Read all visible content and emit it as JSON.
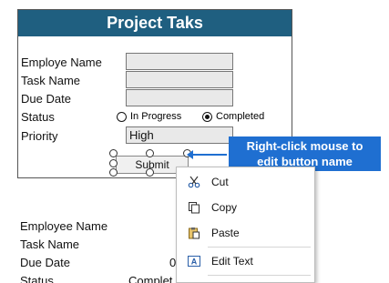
{
  "form": {
    "title": "Project Taks",
    "labels": {
      "employee_name": "Employe  Name",
      "task_name": "Task Name",
      "due_date": "Due Date",
      "status": "Status",
      "priority": "Priority"
    },
    "fields": {
      "employee_name": "",
      "task_name": "",
      "due_date": "",
      "priority": "High"
    },
    "status_options": [
      {
        "label": "In Progress",
        "selected": false
      },
      {
        "label": "Completed",
        "selected": true
      }
    ],
    "submit_label": "Submit"
  },
  "callout": {
    "line1": "Right-click mouse to",
    "line2": "edit button name",
    "color": "#1f6fd1"
  },
  "background_sheet": {
    "labels": [
      "Employee Name",
      "Task Name",
      "Due Date",
      "Status"
    ],
    "values": [
      "",
      "",
      "0",
      "Complet"
    ]
  },
  "context_menu": {
    "items": [
      {
        "label": "Cut",
        "icon": "scissors-icon"
      },
      {
        "label": "Copy",
        "icon": "copy-icon"
      },
      {
        "label": "Paste",
        "icon": "paste-icon"
      },
      {
        "label": "Edit Text",
        "icon": "edit-text-icon"
      }
    ]
  },
  "colors": {
    "title_bar": "#1f5f80",
    "field_bg": "#e9e9e9"
  }
}
